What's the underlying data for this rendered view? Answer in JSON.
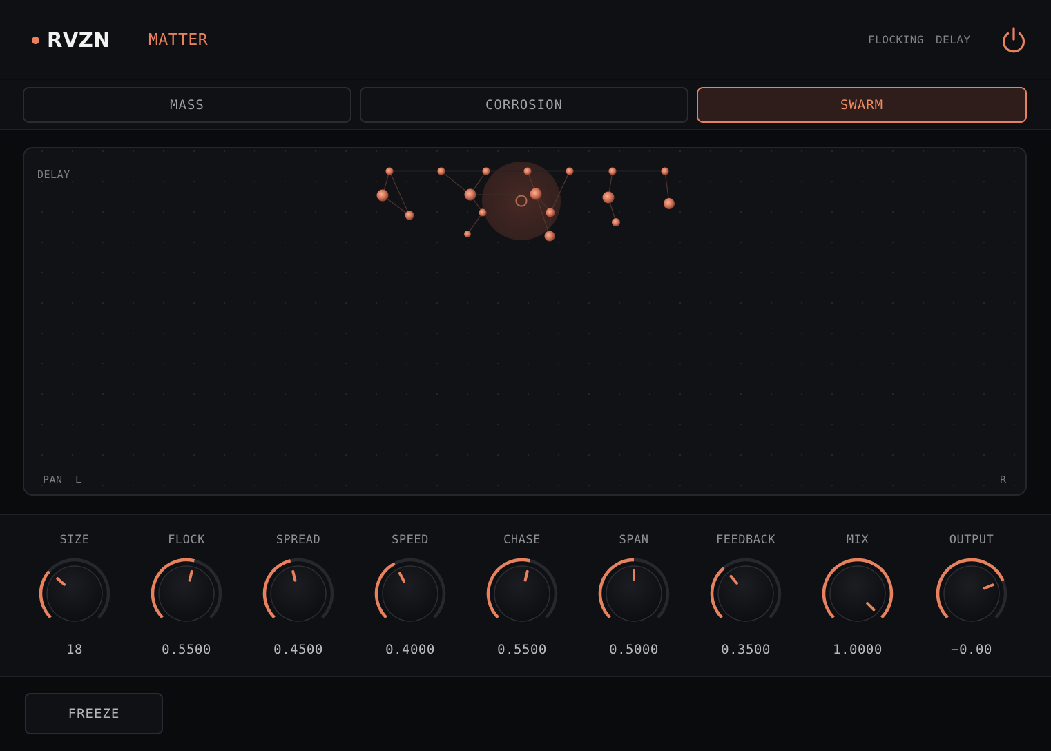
{
  "header": {
    "brand": "RVZN",
    "preset": "MATTER",
    "tags": [
      "FLOCKING",
      "DELAY"
    ],
    "power_icon": "power-icon",
    "accent": "#e8825e"
  },
  "tabs": [
    {
      "label": "MASS",
      "active": false
    },
    {
      "label": "CORROSION",
      "active": false
    },
    {
      "label": "SWARM",
      "active": true
    }
  ],
  "field": {
    "y_label": "DELAY",
    "x_label": "PAN",
    "left_label": "L",
    "right_label": "R"
  },
  "knobs": [
    {
      "label": "SIZE",
      "value": "18",
      "level": 0.32
    },
    {
      "label": "FLOCK",
      "value": "0.5500",
      "level": 0.55
    },
    {
      "label": "SPREAD",
      "value": "0.4500",
      "level": 0.45
    },
    {
      "label": "SPEED",
      "value": "0.4000",
      "level": 0.4
    },
    {
      "label": "CHASE",
      "value": "0.5500",
      "level": 0.55
    },
    {
      "label": "SPAN",
      "value": "0.5000",
      "level": 0.5
    },
    {
      "label": "FEEDBACK",
      "value": "0.3500",
      "level": 0.35
    },
    {
      "label": "MIX",
      "value": "1.0000",
      "level": 1.0
    },
    {
      "label": "OUTPUT",
      "value": "−0.00",
      "level": 0.75
    }
  ],
  "footer": {
    "freeze_label": "FREEZE"
  }
}
